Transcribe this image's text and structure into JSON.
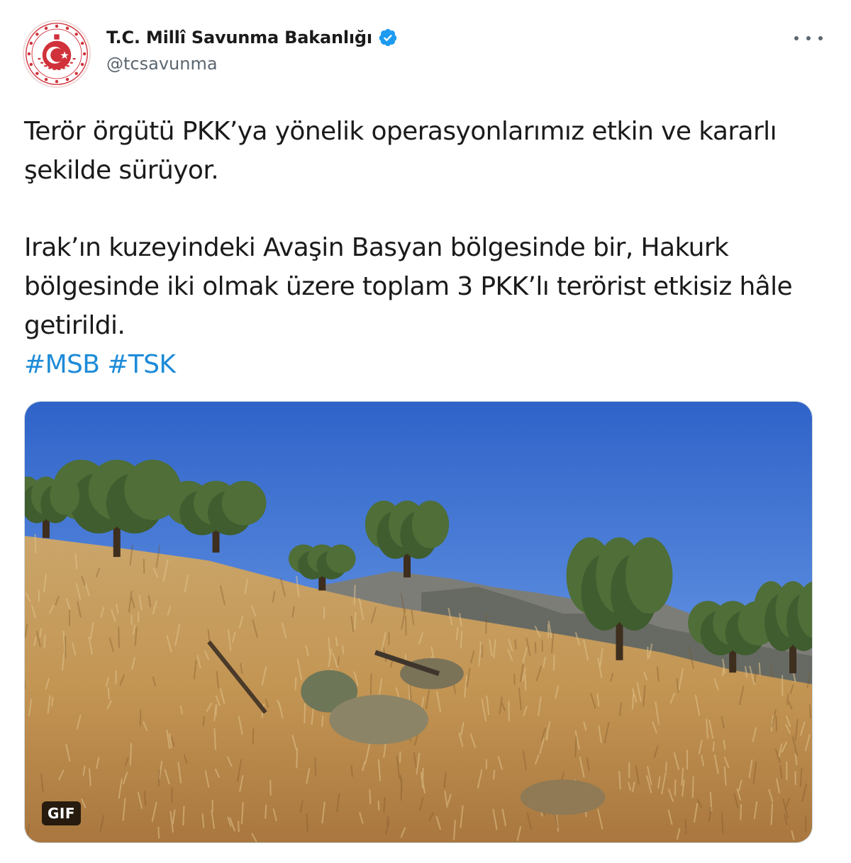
{
  "author": {
    "display_name": "T.C. Millî Savunma Bakanlığı",
    "handle": "@tcsavunma",
    "verified": true,
    "avatar_icon": "ministry-emblem-icon"
  },
  "tweet": {
    "paragraph_1": "Terör örgütü PKK’ya yönelik operasyonlarımız etkin ve kararlı şekilde sürüyor.",
    "paragraph_2": "Irak’ın kuzeyindeki Avaşin Basyan bölgesinde bir, Hakurk bölgesinde iki olmak üzere toplam 3 PKK’lı terörist etkisiz hâle getirildi.",
    "hashtags": [
      "#MSB",
      "#TSK"
    ]
  },
  "media": {
    "type": "gif",
    "badge_label": "GIF"
  },
  "colors": {
    "link": "#1d8bd8",
    "verified": "#1d9bf0",
    "emblem_red": "#d0313a",
    "text": "#1a1a1a",
    "secondary_text": "#5b6670"
  },
  "icons": {
    "more": "more-horizontal-icon",
    "verified": "verified-badge-icon"
  }
}
